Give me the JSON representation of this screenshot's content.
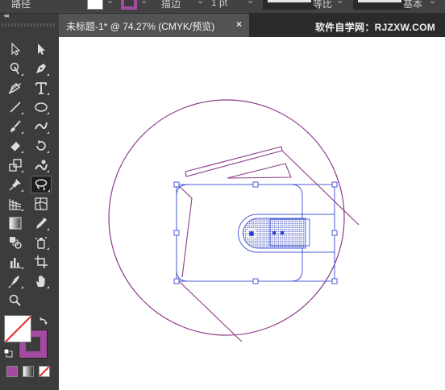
{
  "app": "Adobe Illustrator",
  "control_bar": {
    "shape_label": "路径",
    "stroke_label": "描边",
    "stroke_weight": "1 pt",
    "profile_label": "等比",
    "brush_label": "基本"
  },
  "document_tab": {
    "title": "未标题-1* @ 74.27% (CMYK/预览)",
    "close_symbol": "×"
  },
  "watermark": "软件自学网：RJZXW.COM",
  "toolbar": {
    "collapse_symbol": "◂◂",
    "active_tool": "lasso-tool",
    "tools": [
      {
        "name": "selection-tool",
        "icon": "arrow-outline-icon"
      },
      {
        "name": "direct-selection-tool",
        "icon": "arrow-solid-icon"
      },
      {
        "name": "magic-wand-tool",
        "icon": "magic-wand-icon"
      },
      {
        "name": "pen-tool",
        "icon": "pen-icon"
      },
      {
        "name": "curvature-tool",
        "icon": "curvature-icon"
      },
      {
        "name": "type-tool",
        "icon": "type-icon",
        "label": "T"
      },
      {
        "name": "line-tool",
        "icon": "line-icon"
      },
      {
        "name": "ellipse-tool",
        "icon": "ellipse-icon"
      },
      {
        "name": "paintbrush-tool",
        "icon": "paintbrush-icon"
      },
      {
        "name": "shaper-tool",
        "icon": "shaper-icon"
      },
      {
        "name": "eraser-tool",
        "icon": "eraser-icon"
      },
      {
        "name": "rotate-tool",
        "icon": "rotate-icon"
      },
      {
        "name": "scale-tool",
        "icon": "scale-icon"
      },
      {
        "name": "puppet-warp-tool",
        "icon": "puppet-warp-icon"
      },
      {
        "name": "pin-tool",
        "icon": "pin-icon"
      },
      {
        "name": "lasso-tool",
        "icon": "lasso-icon"
      },
      {
        "name": "perspective-grid-tool",
        "icon": "perspective-grid-icon"
      },
      {
        "name": "mesh-tool",
        "icon": "mesh-icon"
      },
      {
        "name": "gradient-tool",
        "icon": "gradient-icon"
      },
      {
        "name": "eyedropper-tool",
        "icon": "eyedropper-icon"
      },
      {
        "name": "blend-tool",
        "icon": "blend-icon"
      },
      {
        "name": "symbol-sprayer-tool",
        "icon": "symbol-sprayer-icon"
      },
      {
        "name": "column-graph-tool",
        "icon": "column-graph-icon"
      },
      {
        "name": "artboard-tool",
        "icon": "artboard-icon"
      },
      {
        "name": "slice-tool",
        "icon": "slice-icon"
      },
      {
        "name": "hand-tool",
        "icon": "hand-icon"
      },
      {
        "name": "zoom-tool",
        "icon": "zoom-icon"
      }
    ]
  },
  "colors": {
    "fill": "none",
    "stroke": "#a24b9f",
    "artwork_stroke": "#8b3a8a",
    "selection": "#4a5bd6"
  }
}
